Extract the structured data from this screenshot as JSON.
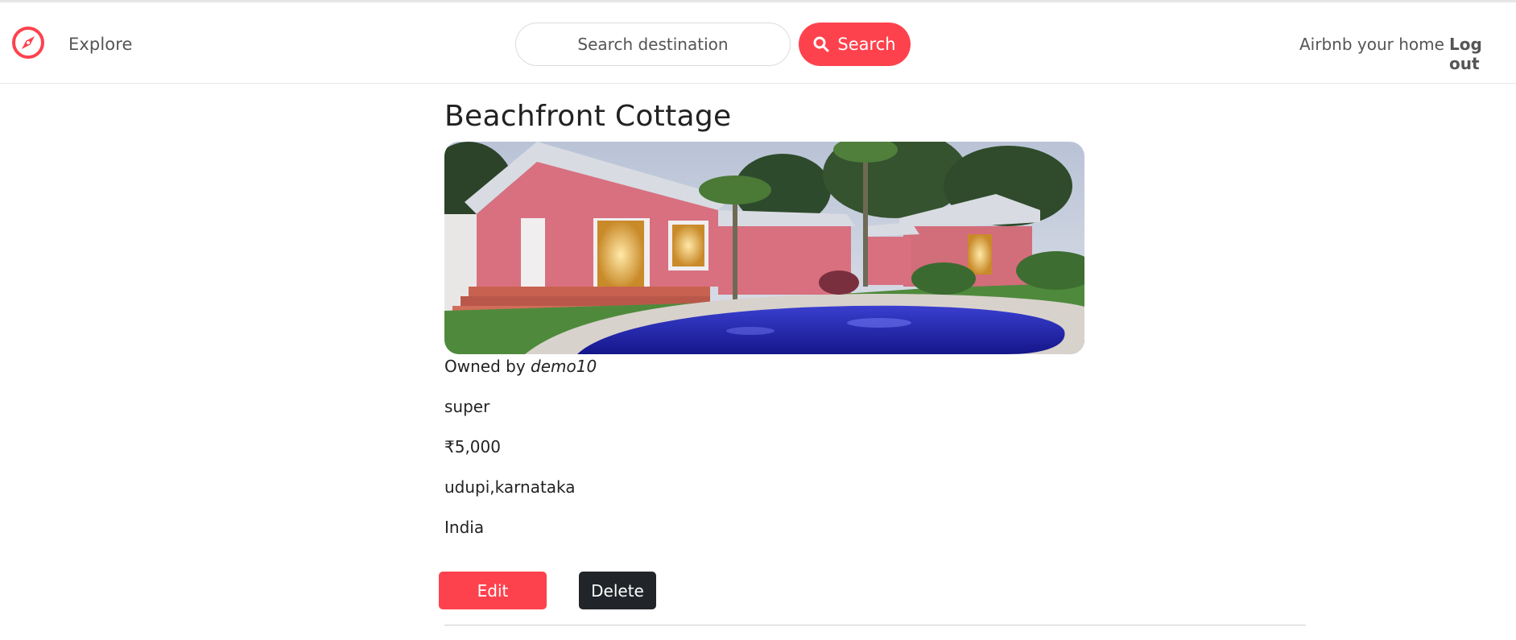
{
  "navbar": {
    "logo_icon": "compass-icon",
    "explore_label": "Explore",
    "search": {
      "placeholder": "Search destination",
      "button_label": "Search",
      "button_icon": "search-icon"
    },
    "host_label": "Airbnb your home",
    "logout_label": "Log out"
  },
  "listing": {
    "title": "Beachfront Cottage",
    "owner_prefix": "Owned by",
    "owner": "demo10",
    "description": "super",
    "price": "₹5,000",
    "location": "udupi,karnataka",
    "country": "India",
    "edit_label": "Edit",
    "delete_label": "Delete"
  },
  "colors": {
    "brand": "#fe424d",
    "dark_button": "#212529"
  }
}
